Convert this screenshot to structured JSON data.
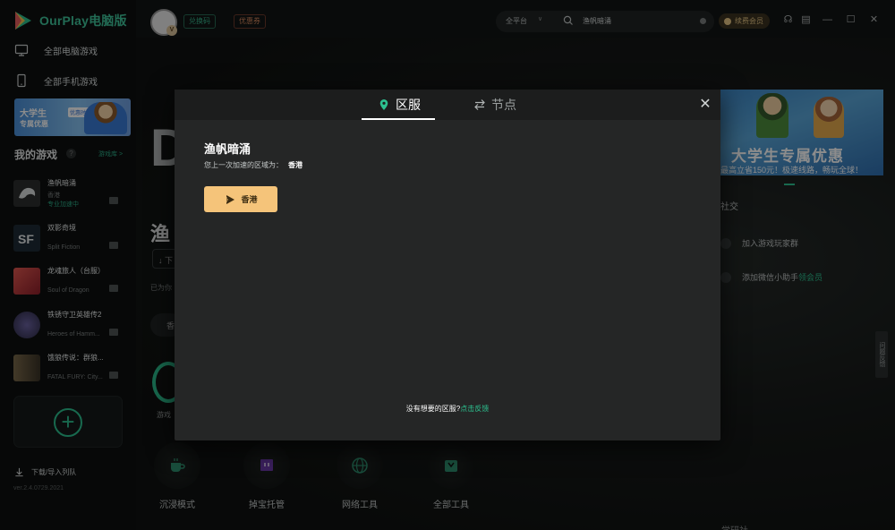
{
  "app": {
    "brand": "OurPlay电脑版",
    "version": "ver.2.4.0729.2021"
  },
  "sidebar": {
    "nav": [
      {
        "label": "全部电脑游戏",
        "icon": "monitor-icon"
      },
      {
        "label": "全部手机游戏",
        "icon": "phone-icon"
      }
    ],
    "promo": {
      "title": "大学生",
      "tag": "优惠时间",
      "subtitle": "专属优惠"
    },
    "my_games_title": "我的游戏",
    "my_games_more": "游戏库 >",
    "games": [
      {
        "title": "渔帆暗涌",
        "sub": "香港",
        "status": "专业加速中",
        "icon_color": "#2c2f2f"
      },
      {
        "title": "双影奇境",
        "sub": "Split Fiction",
        "status": "",
        "icon_color": "#1e2a36"
      },
      {
        "title": "龙魂旅人（台服）",
        "sub": "Soul of Dragon",
        "status": "",
        "icon_color": "#b23b3b"
      },
      {
        "title": "铁锈守卫英雄传2",
        "sub": "Heroes of Hamm...",
        "status": "",
        "icon_color": "#3d3a5a"
      },
      {
        "title": "饿狼传说：群狼...",
        "sub": "FATAL FURY: City...",
        "status": "",
        "icon_color": "#5a4a3a"
      }
    ],
    "download_queue": "下载/导入列队"
  },
  "topbar": {
    "redeem_code": "兑换码",
    "coupon": "优惠券",
    "platform": "全平台",
    "search_value": "渔帆暗涌",
    "vip": "续费会员",
    "controls": [
      "headset-icon",
      "menu-icon",
      "minimize-icon",
      "maximize-icon",
      "close-icon"
    ]
  },
  "main": {
    "big_letter": "D",
    "game_title": "渔",
    "accelerated_text": "已为你",
    "region_btn": "香",
    "ring_label": "游戏",
    "tools": [
      {
        "label": "沉浸模式",
        "icon": "coffee-icon"
      },
      {
        "label": "掉宝托管",
        "icon": "twitch-icon"
      },
      {
        "label": "网络工具",
        "icon": "globe-icon"
      },
      {
        "label": "全部工具",
        "icon": "toolbox-icon"
      }
    ]
  },
  "right_panel": {
    "banner_title": "大学生专属优惠",
    "banner_sub": "最高立省150元！极速线路，畅玩全球！",
    "social_title": "社交",
    "social_items": [
      {
        "label": "加入游戏玩家群",
        "extra": ""
      },
      {
        "label": "添加微信小助手",
        "extra": "领会员"
      }
    ],
    "feedback_tab": "问题反馈",
    "bottom_text": "学研社"
  },
  "modal": {
    "tabs": [
      {
        "label": "区服",
        "icon": "location-pin-icon",
        "active": true
      },
      {
        "label": "节点",
        "icon": "swap-arrows-icon",
        "active": false
      }
    ],
    "game_name": "渔帆暗涌",
    "last_region_label": "您上一次加速的区域为：",
    "last_region_value": "香港",
    "region_button": "香港",
    "no_region_text": "没有想要的区服?",
    "feedback_link": "点击反馈"
  },
  "colors": {
    "accent_green": "#2cc08f",
    "region_button": "#f5c47a",
    "modal_bg": "#252626",
    "vip_gold": "#e3c383"
  }
}
